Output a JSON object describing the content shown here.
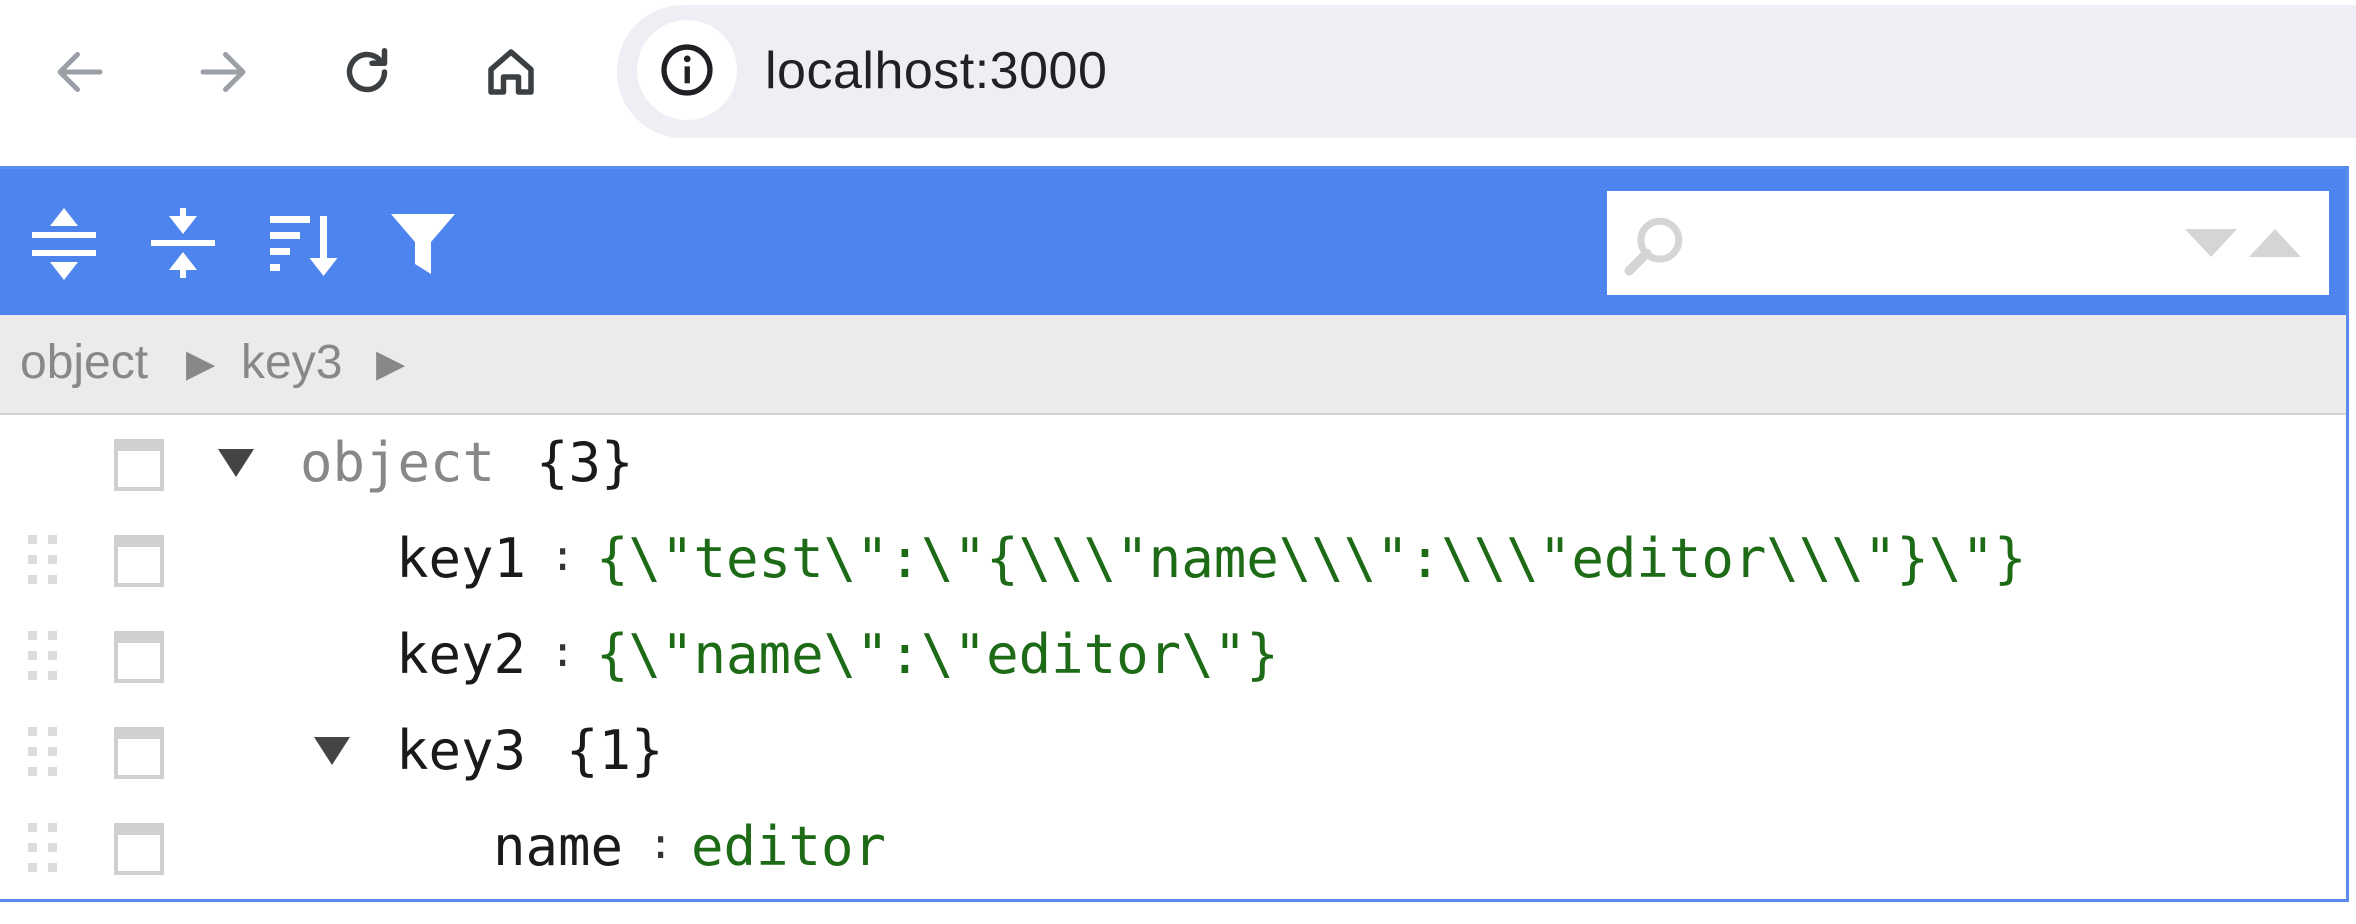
{
  "browser": {
    "url": "localhost:3000",
    "nav_icons": [
      "back-arrow-icon",
      "forward-arrow-icon",
      "reload-icon",
      "home-icon",
      "info-icon"
    ]
  },
  "toolbar": {
    "icons": [
      "expand-all-icon",
      "collapse-all-icon",
      "sort-icon",
      "filter-icon"
    ],
    "search_value": ""
  },
  "navbar": {
    "crumbs": [
      "object",
      "key3"
    ],
    "separator": "▶"
  },
  "tree": {
    "root": {
      "field": "object",
      "count": "{3}"
    },
    "rows": [
      {
        "field": "key1",
        "separator": ":",
        "value": "{\\\"test\\\":\\\"{\\\\\\\"name\\\\\\\":\\\\\\\"editor\\\\\\\"}\\\"}"
      },
      {
        "field": "key2",
        "separator": ":",
        "value": "{\\\"name\\\":\\\"editor\\\"}"
      },
      {
        "field": "key3",
        "count": "{1}"
      },
      {
        "field": "name",
        "separator": ":",
        "value": "editor"
      }
    ]
  },
  "colors": {
    "toolbar_bg": "#4e84ee",
    "string_value": "#1d6b16",
    "omnibox_bg": "#edeff4"
  }
}
